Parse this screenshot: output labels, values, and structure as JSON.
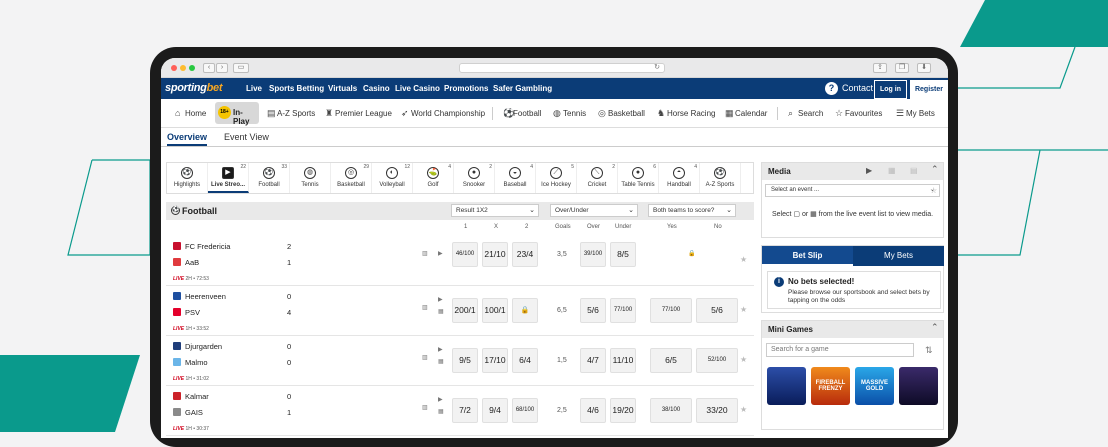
{
  "colors": {
    "brand": "#0b3c77",
    "accent": "#f5a623",
    "teal": "#0a9a8c",
    "live": "#d0021b"
  },
  "browser": {
    "back_icon": "chevron-left-icon",
    "forward_icon": "chevron-right-icon"
  },
  "brand": {
    "logo_part1": "sporting",
    "logo_part2": "bet"
  },
  "topnav": {
    "items": [
      "Live",
      "Sports Betting",
      "Virtuals",
      "Casino",
      "Live Casino",
      "Promotions",
      "Safer Gambling"
    ],
    "help_icon": "?",
    "contact": "Contact",
    "login": "Log in",
    "register": "Register"
  },
  "subnav": {
    "home": "Home",
    "inplay_badge": "18+",
    "inplay": "In-Play",
    "az_sports": "A-Z Sports",
    "premier_league": "Premier League",
    "world_championship": "World Championship",
    "football": "Football",
    "tennis": "Tennis",
    "basketball": "Basketball",
    "horse_racing": "Horse Racing",
    "calendar": "Calendar",
    "search": "Search",
    "favourites": "Favourites",
    "my_bets": "My Bets"
  },
  "tabs": {
    "overview": "Overview",
    "event_view": "Event View"
  },
  "sports_bar": [
    {
      "label": "Highlights",
      "count": ""
    },
    {
      "label": "Live Streo...",
      "count": "22"
    },
    {
      "label": "Football",
      "count": "33"
    },
    {
      "label": "Tennis",
      "count": ""
    },
    {
      "label": "Basketball",
      "count": "29"
    },
    {
      "label": "Volleyball",
      "count": "12"
    },
    {
      "label": "Golf",
      "count": "4"
    },
    {
      "label": "Snooker",
      "count": "2"
    },
    {
      "label": "Baseball",
      "count": "4"
    },
    {
      "label": "Ice Hockey",
      "count": "5"
    },
    {
      "label": "Cricket",
      "count": "2"
    },
    {
      "label": "Table Tennis",
      "count": "6"
    },
    {
      "label": "Handball",
      "count": "4"
    },
    {
      "label": "A-Z Sports",
      "count": ""
    }
  ],
  "football": {
    "title": "Football",
    "market1": "Result 1X2",
    "market2": "Over/Under",
    "market3": "Both teams to score?",
    "col_1": "1",
    "col_x": "X",
    "col_2": "2",
    "col_goals": "Goals",
    "col_over": "Over",
    "col_under": "Under",
    "col_yes": "Yes",
    "col_no": "No"
  },
  "matches": [
    {
      "home": "FC Fredericia",
      "away": "AaB",
      "home_score": "2",
      "away_score": "1",
      "live": "LIVE",
      "time": "2H • 72:53",
      "o1": "46/100",
      "ox": "21/10",
      "o2": "23/4",
      "goals": "3,5",
      "over": "39/100",
      "under": "8/5",
      "yes": "",
      "no": ""
    },
    {
      "home": "Heerenveen",
      "away": "PSV",
      "home_score": "0",
      "away_score": "4",
      "live": "LIVE",
      "time": "1H • 33:52",
      "o1": "200/1",
      "ox": "100/1",
      "o2": "",
      "goals": "6,5",
      "over": "5/6",
      "under": "77/100",
      "yes": "77/100",
      "no": "5/6"
    },
    {
      "home": "Djurgarden",
      "away": "Malmo",
      "home_score": "0",
      "away_score": "0",
      "live": "LIVE",
      "time": "1H • 31:02",
      "o1": "9/5",
      "ox": "17/10",
      "o2": "6/4",
      "goals": "1,5",
      "over": "4/7",
      "under": "11/10",
      "yes": "6/5",
      "no": "52/100"
    },
    {
      "home": "Kalmar",
      "away": "GAIS",
      "home_score": "0",
      "away_score": "1",
      "live": "LIVE",
      "time": "1H • 30:37",
      "o1": "7/2",
      "ox": "9/4",
      "o2": "68/100",
      "goals": "2,5",
      "over": "4/6",
      "under": "19/20",
      "yes": "38/100",
      "no": "33/20"
    }
  ],
  "media": {
    "title": "Media",
    "select_placeholder": "Select an event ...",
    "text": "Select ▢ or ▦ from the live event list to view media."
  },
  "betslip": {
    "tab1": "Bet Slip",
    "tab2": "My Bets",
    "heading": "No bets selected!",
    "info_icon": "i",
    "message": "Please browse our sportsbook and select bets by tapping on the odds"
  },
  "mini_games": {
    "title": "Mini Games",
    "search_placeholder": "Search for a game",
    "games": [
      "",
      "FIREBALL FRENZY",
      "MASSIVE GOLD",
      ""
    ]
  }
}
